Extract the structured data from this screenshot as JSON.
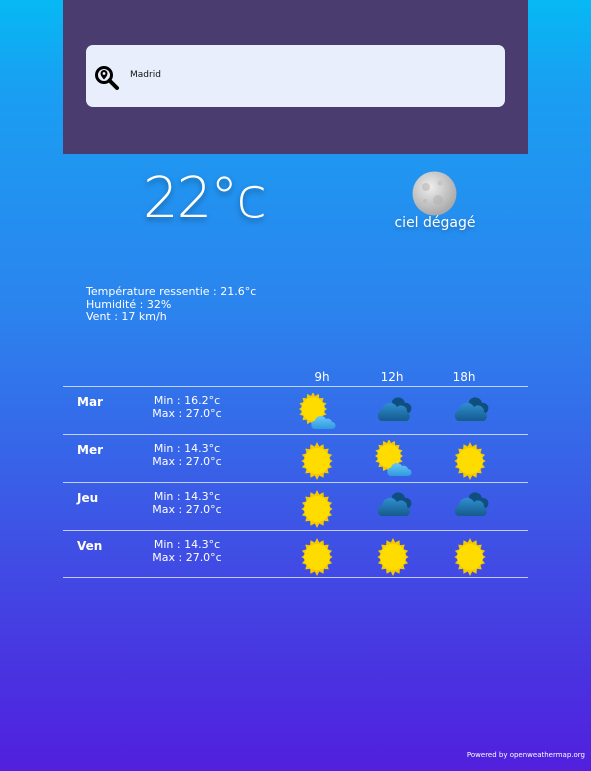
{
  "search": {
    "value": "Madrid"
  },
  "current": {
    "temperature": "22°c",
    "condition": "ciel dégagé",
    "condition_icon": "moon-icon",
    "feels_like": "Température ressentie : 21.6°c",
    "humidity": "Humidité : 32%",
    "wind": "Vent : 17 km/h"
  },
  "forecast": {
    "hours": [
      "9h",
      "12h",
      "18h"
    ],
    "days": [
      {
        "day": "Mar",
        "min": "Min : 16.2°c",
        "max": "Max : 27.0°c",
        "icons": [
          "sun-cloud-icon",
          "cloud-icon",
          "cloud-icon"
        ]
      },
      {
        "day": "Mer",
        "min": "Min : 14.3°c",
        "max": "Max : 27.0°c",
        "icons": [
          "sun-icon",
          "sun-cloud-icon",
          "sun-icon"
        ]
      },
      {
        "day": "Jeu",
        "min": "Min : 14.3°c",
        "max": "Max : 27.0°c",
        "icons": [
          "sun-icon",
          "cloud-icon",
          "cloud-icon"
        ]
      },
      {
        "day": "Ven",
        "min": "Min : 14.3°c",
        "max": "Max : 27.0°c",
        "icons": [
          "sun-icon",
          "sun-icon",
          "sun-icon"
        ]
      }
    ]
  },
  "footer": {
    "powered": "Powered by openweathermap.org"
  },
  "colors": {
    "panel": "#4a3c6e",
    "search_box": "#e8eefb",
    "sun": "#ffd400",
    "cloud": "#1e6fa8"
  }
}
